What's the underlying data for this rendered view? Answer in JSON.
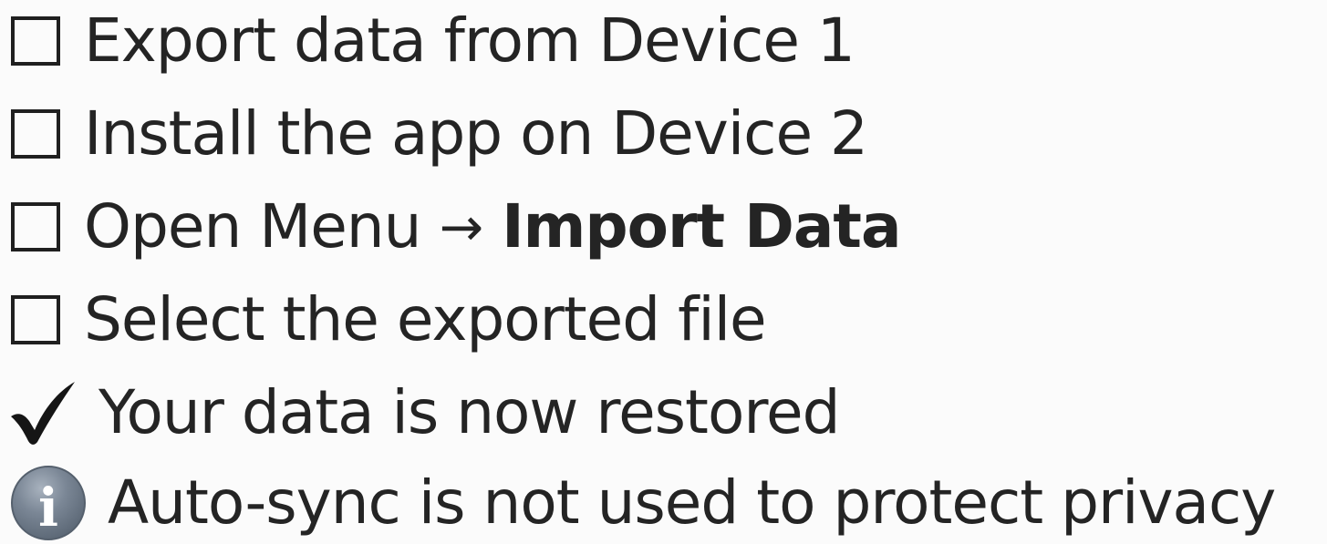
{
  "steps": [
    {
      "text": "Export data from Device 1",
      "icon": "checkbox-icon"
    },
    {
      "text": "Install the app on Device 2",
      "icon": "checkbox-icon"
    },
    {
      "text": "Open Menu",
      "arrow": "→",
      "bold_text": "Import Data",
      "icon": "checkbox-icon"
    },
    {
      "text": "Select the exported file",
      "icon": "checkbox-icon"
    }
  ],
  "result": {
    "text": "Your data is now restored",
    "icon": "checkmark-icon"
  },
  "info": {
    "text": "Auto-sync is not used to protect privacy",
    "icon": "info-icon",
    "icon_letter": "i"
  },
  "colors": {
    "background": "#fbfbfb",
    "text": "#242424",
    "info_icon": "#7b8796"
  }
}
